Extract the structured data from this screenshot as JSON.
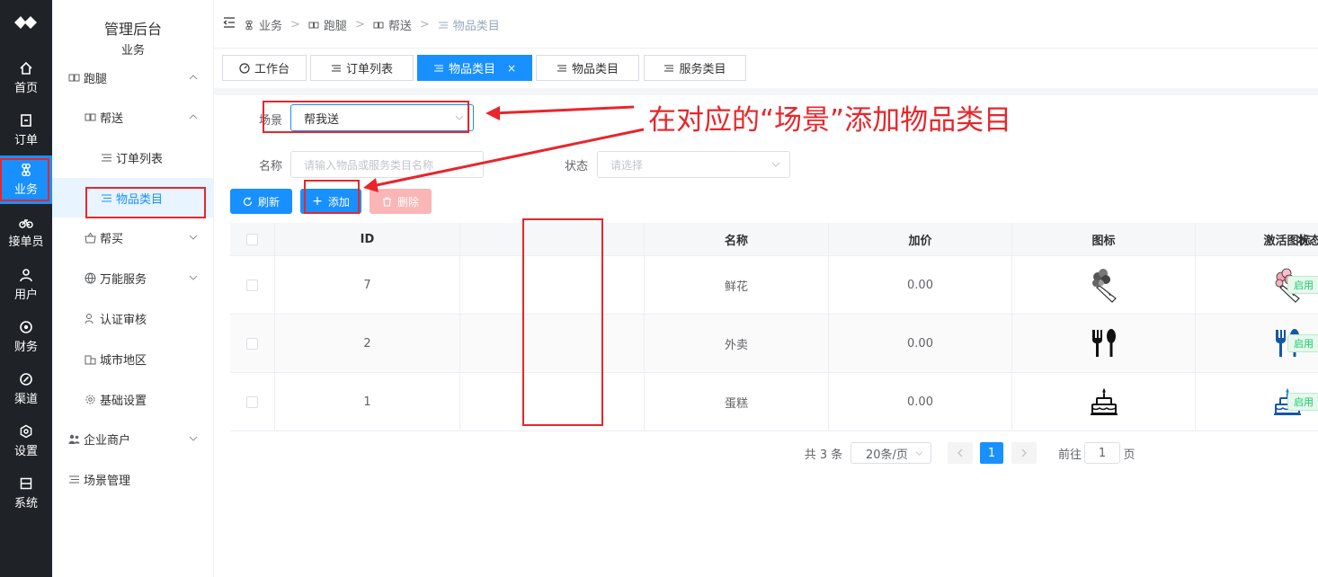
{
  "rail": {
    "items": [
      {
        "label": "首页",
        "icon": "home-icon"
      },
      {
        "label": "订单",
        "icon": "order-icon"
      },
      {
        "label": "业务",
        "icon": "command-icon"
      },
      {
        "label": "接单员",
        "icon": "bicycle-icon"
      },
      {
        "label": "用户",
        "icon": "user-icon"
      },
      {
        "label": "财务",
        "icon": "finance-icon"
      },
      {
        "label": "渠道",
        "icon": "channel-icon"
      },
      {
        "label": "设置",
        "icon": "settings-icon"
      },
      {
        "label": "系统",
        "icon": "system-icon"
      }
    ],
    "active_color": "#1890ff"
  },
  "sidebar": {
    "app_title": "管理后台",
    "section_title": "业务",
    "items": [
      {
        "label": "跑腿"
      },
      {
        "label": "帮送"
      },
      {
        "label": "订单列表"
      },
      {
        "label": "物品类目"
      },
      {
        "label": "帮买"
      },
      {
        "label": "万能服务"
      },
      {
        "label": "认证审核"
      },
      {
        "label": "城市地区"
      },
      {
        "label": "基础设置"
      },
      {
        "label": "企业商户"
      },
      {
        "label": "场景管理"
      }
    ]
  },
  "breadcrumb": [
    "业务",
    "跑腿",
    "帮送",
    "物品类目"
  ],
  "tabs": [
    {
      "label": "工作台"
    },
    {
      "label": "订单列表"
    },
    {
      "label": "物品类目",
      "close": "×"
    },
    {
      "label": "物品类目"
    },
    {
      "label": "服务类目"
    }
  ],
  "filters": {
    "scene_label": "场景",
    "scene_value": "帮我送",
    "name_label": "名称",
    "name_placeholder": "请输入物品或服务类目名称",
    "status_label": "状态",
    "status_placeholder": "请选择"
  },
  "toolbar": {
    "refresh_label": "刷新",
    "add_label": "添加",
    "delete_label": "删除"
  },
  "table": {
    "headers": [
      "ID",
      "名称",
      "加价",
      "图标",
      "激活图标",
      "状态"
    ],
    "rows": [
      {
        "id": "7",
        "name": "鲜花",
        "price": "0.00",
        "icon": "flower-bouquet-icon",
        "status": "启用"
      },
      {
        "id": "2",
        "name": "外卖",
        "price": "0.00",
        "icon": "fork-spoon-icon",
        "status": "启用"
      },
      {
        "id": "1",
        "name": "蛋糕",
        "price": "0.00",
        "icon": "cake-icon",
        "status": "启用"
      }
    ]
  },
  "pagination": {
    "total": "共 3 条",
    "page_size": "20条/页",
    "current_page": "1",
    "goto_label": "前往",
    "goto_value": "1",
    "page_unit": "页"
  },
  "annotation": {
    "text": "在对应的“场景”添加物品类目",
    "color": "#e8262b"
  }
}
